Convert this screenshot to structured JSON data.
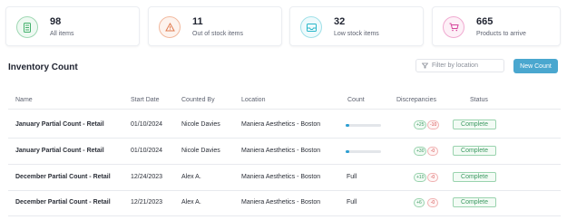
{
  "stats": [
    {
      "value": "98",
      "label": "All items",
      "icon": "document-list-icon",
      "color": "#43b06b"
    },
    {
      "value": "11",
      "label": "Out of stock items",
      "icon": "warning-triangle-icon",
      "color": "#e07b4f"
    },
    {
      "value": "32",
      "label": "Low stock items",
      "icon": "inbox-icon",
      "color": "#29b7c9"
    },
    {
      "value": "665",
      "label": "Products to arrive",
      "icon": "cart-icon",
      "color": "#d6459b"
    }
  ],
  "header": {
    "title": "Inventory Count",
    "filter_placeholder": "Filter by location",
    "new_count_label": "New Count"
  },
  "table": {
    "columns": [
      "Name",
      "Start Date",
      "Counted By",
      "Location",
      "Count",
      "Discrepancies",
      "Status"
    ],
    "rows": [
      {
        "name": "January Partial Count - Retail",
        "start_date": "01/10/2024",
        "counted_by": "Nicole Davies",
        "location": "Maniera Aesthetics - Boston",
        "count": "",
        "count_progress": 0.1,
        "disc_pos": "+25",
        "disc_neg": "-10",
        "status": "Complete"
      },
      {
        "name": "January Partial Count - Retail",
        "start_date": "01/10/2024",
        "counted_by": "Nicole Davies",
        "location": "Maniera Aesthetics - Boston",
        "count": "",
        "count_progress": 0.1,
        "disc_pos": "+30",
        "disc_neg": "-0",
        "status": "Complete"
      },
      {
        "name": "December Partial Count - Retail",
        "start_date": "12/24/2023",
        "counted_by": "Alex A.",
        "location": "Maniera Aesthetics - Boston",
        "count": "Full",
        "count_progress": null,
        "disc_pos": "+10",
        "disc_neg": "-0",
        "status": "Complete"
      },
      {
        "name": "December Partial Count - Retail",
        "start_date": "12/21/2023",
        "counted_by": "Alex A.",
        "location": "Maniera Aesthetics - Boston",
        "count": "Full",
        "count_progress": null,
        "disc_pos": "+6",
        "disc_neg": "-0",
        "status": "Complete"
      }
    ]
  }
}
